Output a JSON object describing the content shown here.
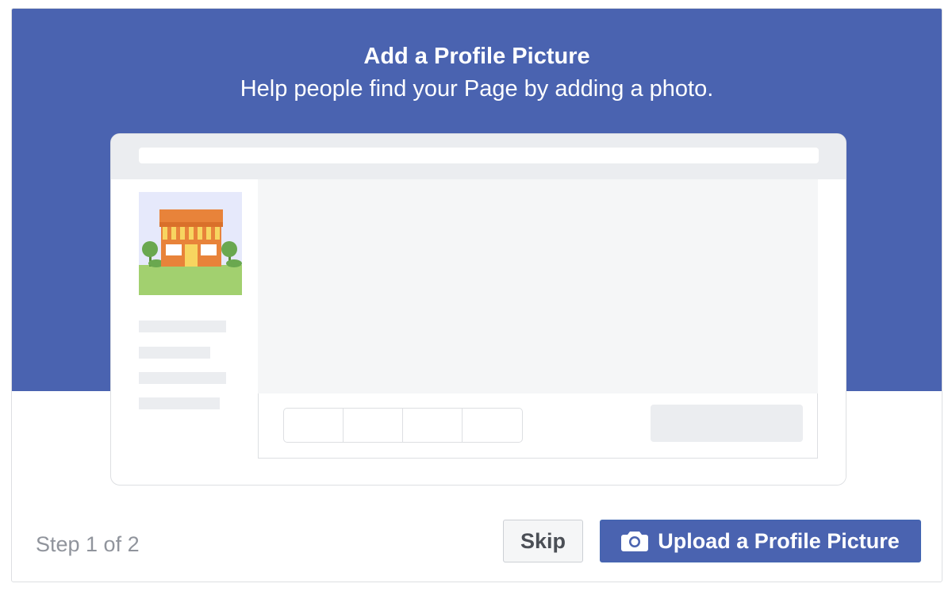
{
  "dialog": {
    "title": "Add a Profile Picture",
    "subtitle": "Help people find your Page by adding a photo."
  },
  "footer": {
    "step_text": "Step 1 of 2",
    "skip_label": "Skip",
    "upload_label": "Upload a Profile Picture",
    "upload_icon": "camera-icon"
  },
  "colors": {
    "hero_background": "#4a63b0",
    "primary_button": "#4a63b0",
    "mock_gray": "#ebedf0",
    "mock_content": "#f5f6f7",
    "illustration_roof": "#e8833a",
    "illustration_grass": "#a2d06f",
    "illustration_sky": "#e6e9fb"
  },
  "illustration": {
    "subject": "storefront-illustration"
  }
}
